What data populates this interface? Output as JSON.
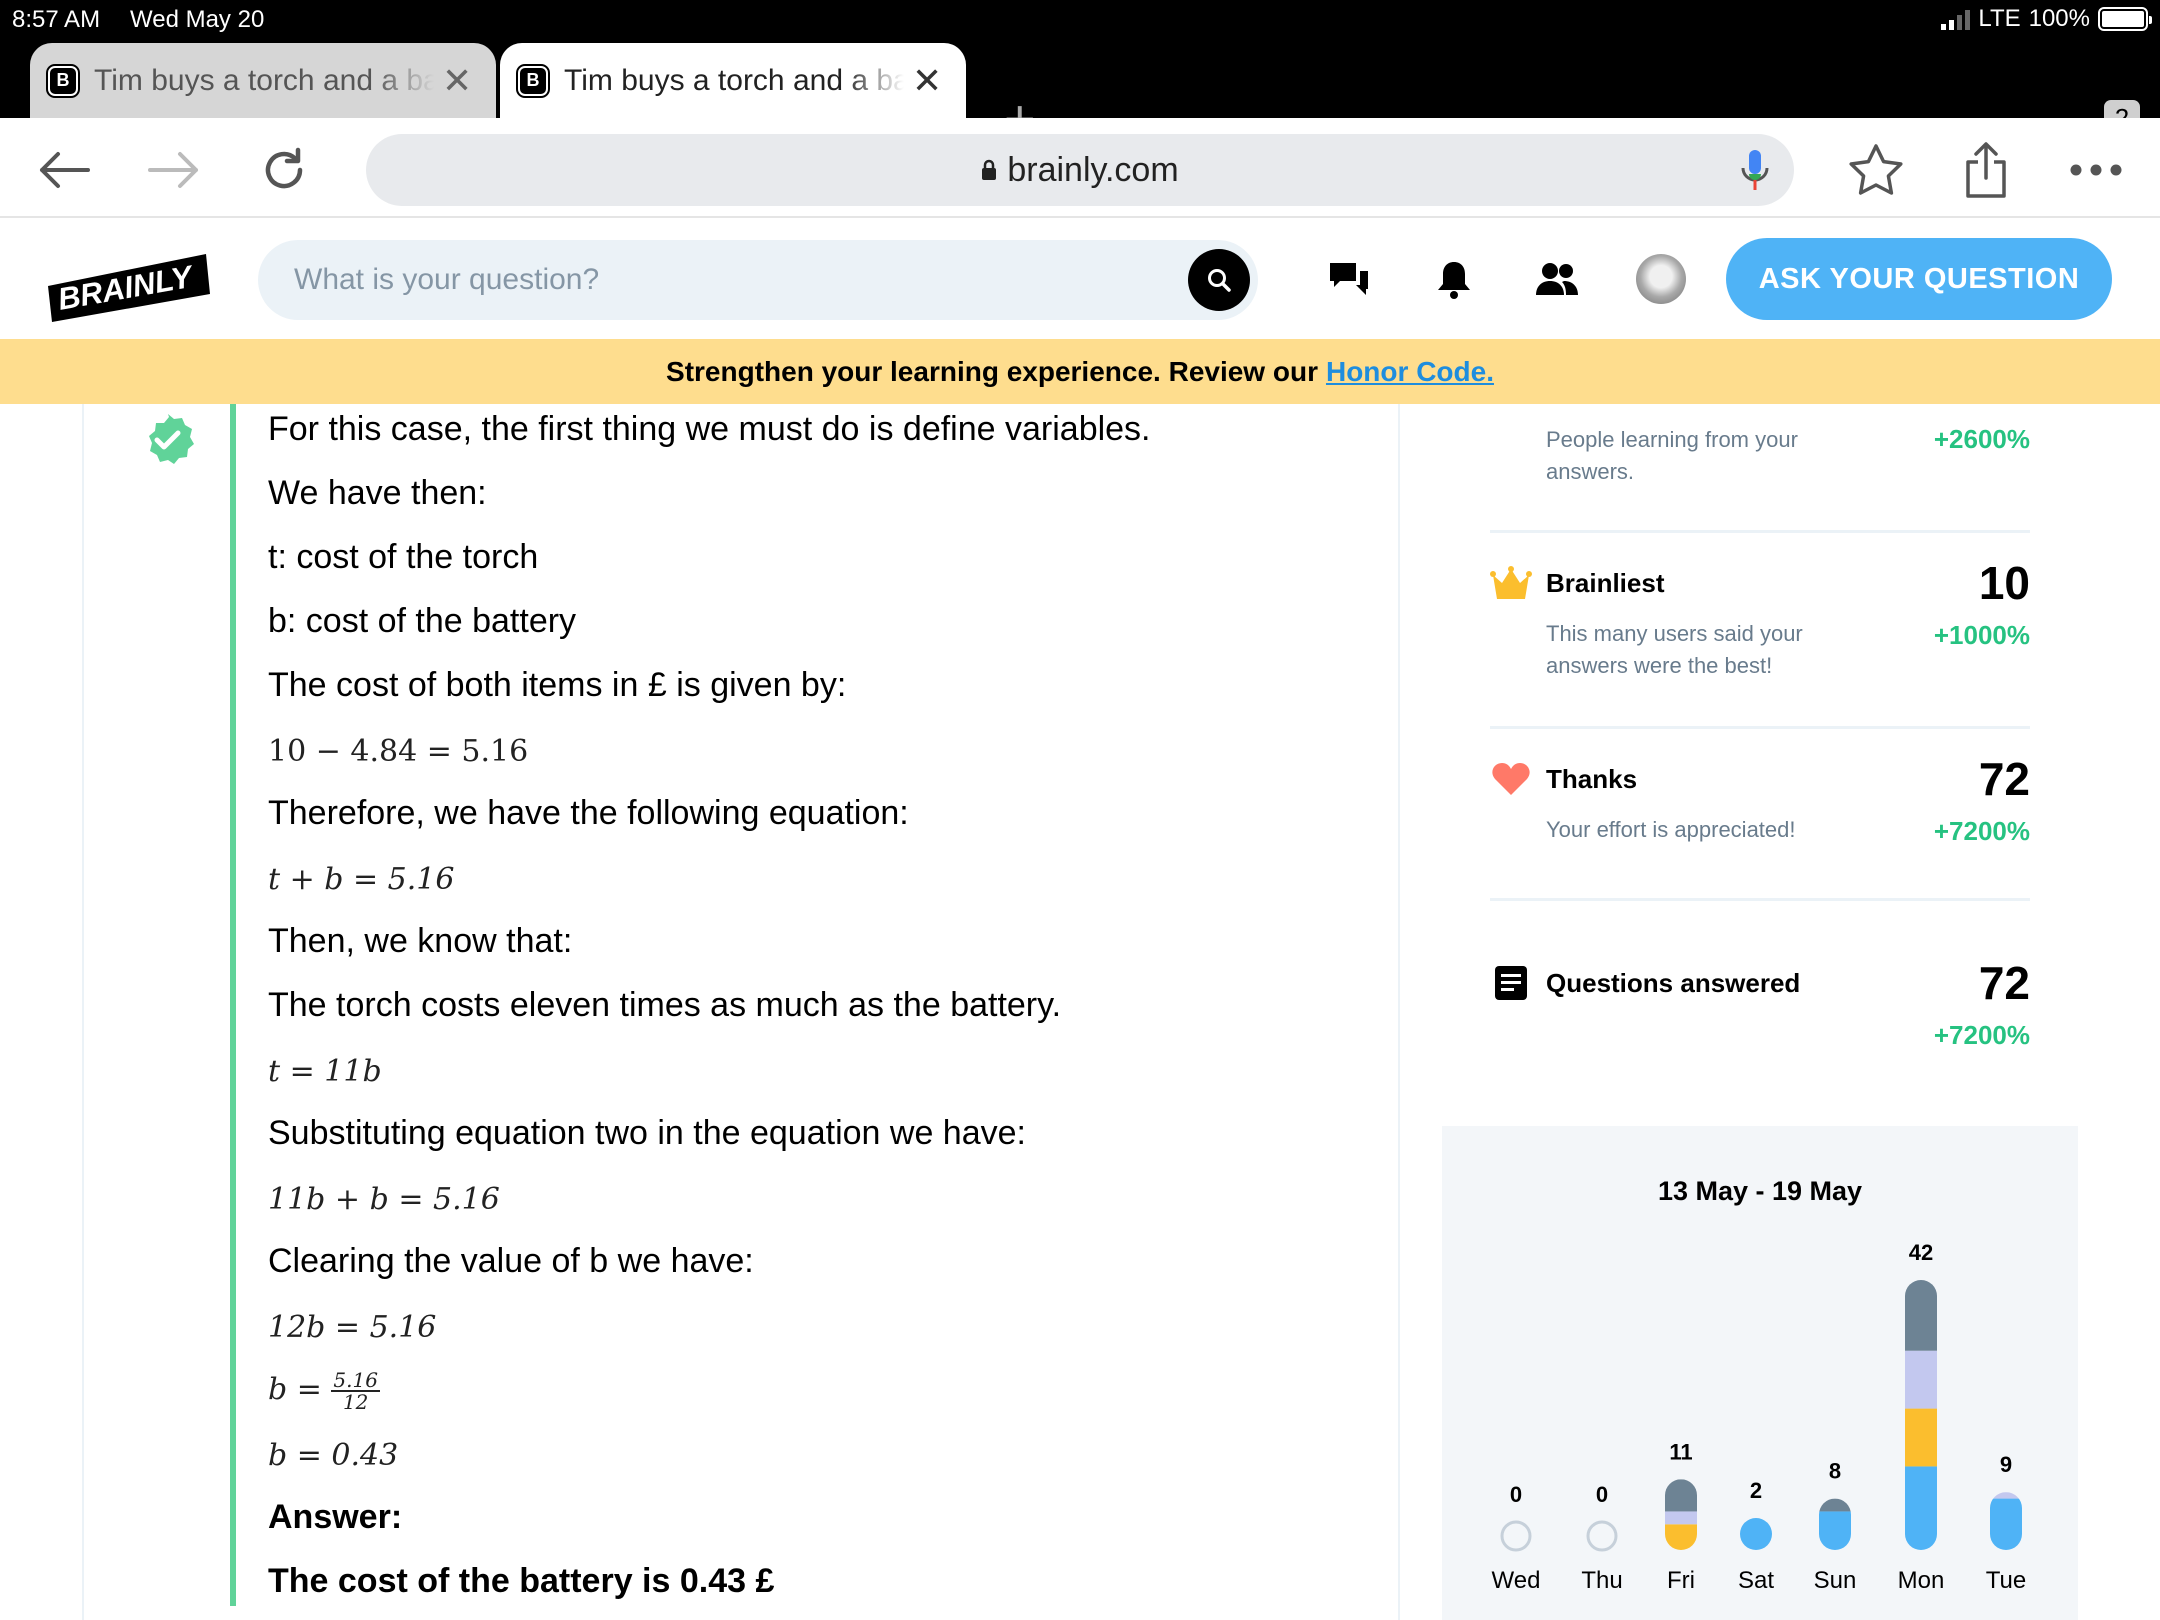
{
  "status_bar": {
    "time": "8:57 AM",
    "date": "Wed May 20",
    "network": "LTE",
    "battery": "100%"
  },
  "tabs": [
    {
      "favicon": "B",
      "title": "Tim buys a torch and a battery",
      "active": false
    },
    {
      "favicon": "B",
      "title": "Tim buys a torch and a battery",
      "active": true
    }
  ],
  "tab_count": "2",
  "url": "brainly.com",
  "header": {
    "logo_text": "BRAINLY",
    "search_placeholder": "What is your question?",
    "ask_button": "ASK YOUR QUESTION"
  },
  "banner": {
    "text": "Strengthen your learning experience. Review our",
    "link": "Honor Code."
  },
  "answer": {
    "lines": [
      "For this case, the first thing we must do is define variables.",
      "We have then:",
      "t: cost of the torch",
      "b: cost of the battery",
      "The cost of both items in £ is given by:",
      "10 − 4.84 = 5.16",
      "Therefore, we have the following equation:",
      "t + b = 5.16",
      "Then, we know that:",
      "The torch costs eleven times as much as the battery.",
      "t = 11b",
      "Substituting equation two in the equation we have:",
      "11b + b = 5.16",
      "Clearing the value of b we have:",
      "12b = 5.16",
      "b = ",
      "b = 0.43",
      "Answer:",
      "The cost of the battery is 0.43 £"
    ],
    "fraction": {
      "numerator": "5.16",
      "denominator": "12"
    }
  },
  "stats": {
    "people": {
      "desc": "People learning from your answers.",
      "pct": "+2600%"
    },
    "brainliest": {
      "label": "Brainliest",
      "value": "10",
      "desc": "This many users said your answers were the best!",
      "pct": "+1000%"
    },
    "thanks": {
      "label": "Thanks",
      "value": "72",
      "desc": "Your effort is appreciated!",
      "pct": "+7200%"
    },
    "questions": {
      "label": "Questions answered",
      "value": "72",
      "pct": "+7200%"
    }
  },
  "colors": {
    "accent": "#4fb3f6",
    "green": "#26c281",
    "banner": "#fedd8e",
    "crown": "#fbbe2e",
    "heart": "#ff7968"
  },
  "chart_data": {
    "type": "bar",
    "title": "13 May - 19 May",
    "categories": [
      "Wed",
      "Thu",
      "Fri",
      "Sat",
      "Sun",
      "Mon",
      "Tue"
    ],
    "values": [
      0,
      0,
      11,
      2,
      8,
      42,
      9
    ],
    "segment_colors": [
      "#4fb3f6",
      "#fbbe2e",
      "#c3c8ef",
      "#6d8394"
    ],
    "segments": [
      [
        0,
        0,
        0,
        0
      ],
      [
        0,
        0,
        0,
        0
      ],
      [
        0,
        4,
        2,
        5
      ],
      [
        2,
        0,
        0,
        0
      ],
      [
        6,
        0,
        0,
        2
      ],
      [
        13,
        9,
        9,
        11
      ],
      [
        8,
        0,
        1,
        0
      ]
    ],
    "ylim": [
      0,
      42
    ]
  }
}
